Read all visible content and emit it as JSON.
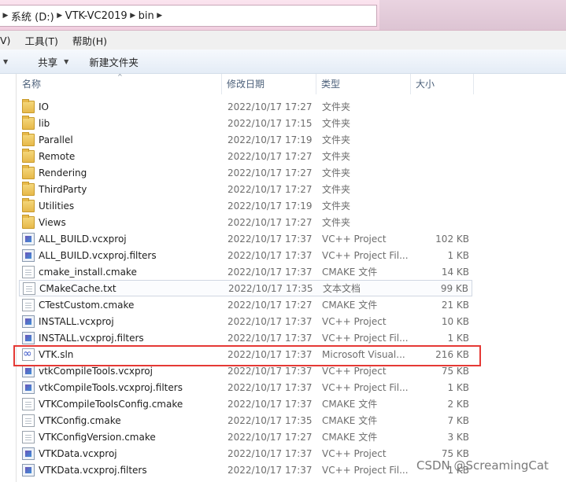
{
  "address": {
    "crumbs": [
      "系统 (D:)",
      "VTK-VC2019",
      "bin"
    ]
  },
  "menu": {
    "items": [
      "V)",
      "工具(T)",
      "帮助(H)"
    ]
  },
  "toolbar": {
    "share_label": "共享",
    "new_folder_label": "新建文件夹"
  },
  "columns": {
    "name": "名称",
    "date": "修改日期",
    "type": "类型",
    "size": "大小"
  },
  "files": [
    {
      "name": "IO",
      "date": "2022/10/17 17:27",
      "type": "文件夹",
      "size": "",
      "icon": "folder-icon"
    },
    {
      "name": "lib",
      "date": "2022/10/17 17:15",
      "type": "文件夹",
      "size": "",
      "icon": "folder-icon"
    },
    {
      "name": "Parallel",
      "date": "2022/10/17 17:19",
      "type": "文件夹",
      "size": "",
      "icon": "folder-icon"
    },
    {
      "name": "Remote",
      "date": "2022/10/17 17:27",
      "type": "文件夹",
      "size": "",
      "icon": "folder-icon"
    },
    {
      "name": "Rendering",
      "date": "2022/10/17 17:27",
      "type": "文件夹",
      "size": "",
      "icon": "folder-icon"
    },
    {
      "name": "ThirdParty",
      "date": "2022/10/17 17:27",
      "type": "文件夹",
      "size": "",
      "icon": "folder-icon"
    },
    {
      "name": "Utilities",
      "date": "2022/10/17 17:19",
      "type": "文件夹",
      "size": "",
      "icon": "folder-icon"
    },
    {
      "name": "Views",
      "date": "2022/10/17 17:27",
      "type": "文件夹",
      "size": "",
      "icon": "folder-icon"
    },
    {
      "name": "ALL_BUILD.vcxproj",
      "date": "2022/10/17 17:37",
      "type": "VC++ Project",
      "size": "102 KB",
      "icon": "vcxproj-icon"
    },
    {
      "name": "ALL_BUILD.vcxproj.filters",
      "date": "2022/10/17 17:37",
      "type": "VC++ Project Fil...",
      "size": "1 KB",
      "icon": "vcxproj-icon"
    },
    {
      "name": "cmake_install.cmake",
      "date": "2022/10/17 17:37",
      "type": "CMAKE 文件",
      "size": "14 KB",
      "icon": "document-icon"
    },
    {
      "name": "CMakeCache.txt",
      "date": "2022/10/17 17:35",
      "type": "文本文档",
      "size": "99 KB",
      "icon": "document-icon"
    },
    {
      "name": "CTestCustom.cmake",
      "date": "2022/10/17 17:27",
      "type": "CMAKE 文件",
      "size": "21 KB",
      "icon": "document-icon"
    },
    {
      "name": "INSTALL.vcxproj",
      "date": "2022/10/17 17:37",
      "type": "VC++ Project",
      "size": "10 KB",
      "icon": "vcxproj-icon"
    },
    {
      "name": "INSTALL.vcxproj.filters",
      "date": "2022/10/17 17:37",
      "type": "VC++ Project Fil...",
      "size": "1 KB",
      "icon": "vcxproj-icon"
    },
    {
      "name": "VTK.sln",
      "date": "2022/10/17 17:37",
      "type": "Microsoft Visual...",
      "size": "216 KB",
      "icon": "sln-icon"
    },
    {
      "name": "vtkCompileTools.vcxproj",
      "date": "2022/10/17 17:37",
      "type": "VC++ Project",
      "size": "75 KB",
      "icon": "vcxproj-icon"
    },
    {
      "name": "vtkCompileTools.vcxproj.filters",
      "date": "2022/10/17 17:37",
      "type": "VC++ Project Fil...",
      "size": "1 KB",
      "icon": "vcxproj-icon"
    },
    {
      "name": "VTKCompileToolsConfig.cmake",
      "date": "2022/10/17 17:37",
      "type": "CMAKE 文件",
      "size": "2 KB",
      "icon": "document-icon"
    },
    {
      "name": "VTKConfig.cmake",
      "date": "2022/10/17 17:35",
      "type": "CMAKE 文件",
      "size": "7 KB",
      "icon": "document-icon"
    },
    {
      "name": "VTKConfigVersion.cmake",
      "date": "2022/10/17 17:27",
      "type": "CMAKE 文件",
      "size": "3 KB",
      "icon": "document-icon"
    },
    {
      "name": "VTKData.vcxproj",
      "date": "2022/10/17 17:37",
      "type": "VC++ Project",
      "size": "75 KB",
      "icon": "vcxproj-icon"
    },
    {
      "name": "VTKData.vcxproj.filters",
      "date": "2022/10/17 17:37",
      "type": "VC++ Project Fil...",
      "size": "1 KB",
      "icon": "vcxproj-icon"
    }
  ],
  "selected_index": 11,
  "highlighted_index": 15,
  "watermark": "CSDN @ScreamingCat"
}
